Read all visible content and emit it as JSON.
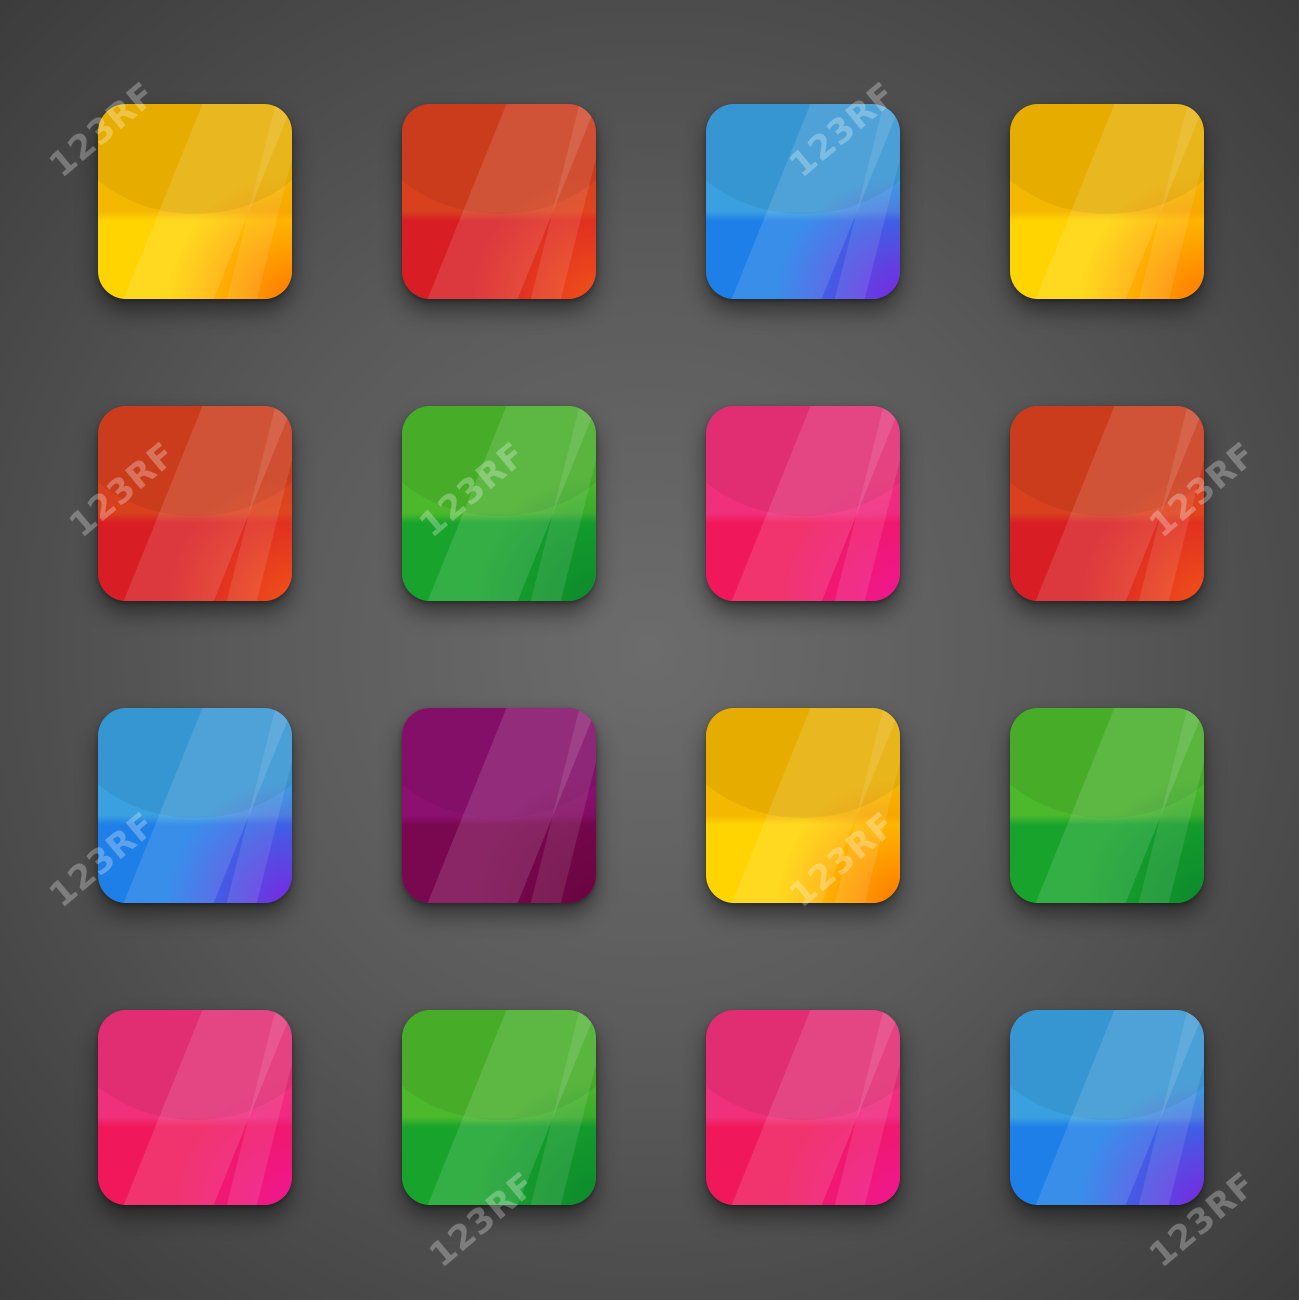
{
  "watermark_text": "123RF",
  "palette": {
    "yellow": {
      "top": "#f5b800",
      "bottom": "#ffd400",
      "corner": "#ff7a00"
    },
    "red": {
      "top": "#d8401e",
      "bottom": "#d81e24",
      "corner": "#f0501a"
    },
    "blue": {
      "top": "#3aa0e0",
      "bottom": "#1e7fe8",
      "corner": "#7a28e0"
    },
    "green": {
      "top": "#4cb82c",
      "bottom": "#18a42c",
      "corner": "#0c8a2c"
    },
    "pink": {
      "top": "#f0307a",
      "bottom": "#f0185a",
      "corner": "#f01890"
    },
    "purple": {
      "top": "#8c1070",
      "bottom": "#7a0850",
      "corner": "#6a0440"
    }
  },
  "buttons": [
    [
      "yellow",
      "red",
      "blue",
      "yellow"
    ],
    [
      "red",
      "green",
      "pink",
      "red"
    ],
    [
      "blue",
      "purple",
      "yellow",
      "green"
    ],
    [
      "pink",
      "green",
      "pink",
      "blue"
    ]
  ]
}
